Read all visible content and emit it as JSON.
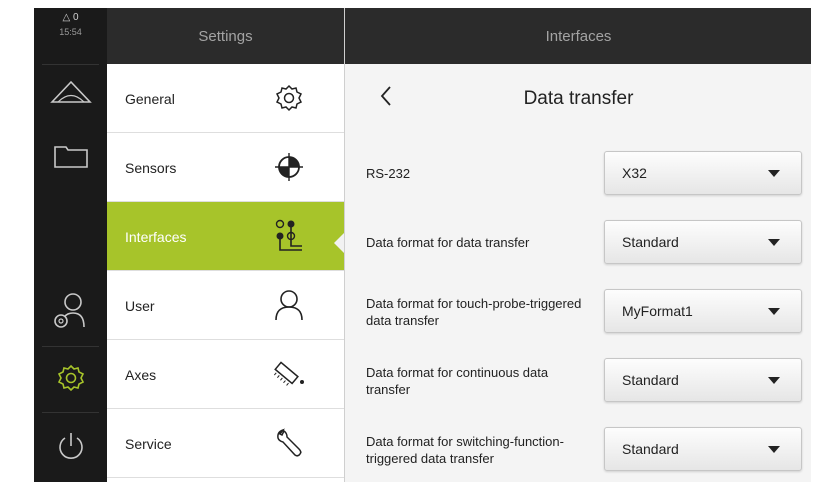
{
  "status": {
    "warning_count": "△ 0",
    "time": "15:54"
  },
  "strip": {
    "items": [
      {
        "icon": "measure-icon"
      },
      {
        "icon": "folder-icon"
      },
      {
        "icon": "user-settings-icon"
      },
      {
        "icon": "settings-gear-icon",
        "active": true
      },
      {
        "icon": "power-icon"
      }
    ],
    "active_color": "#a7c42a"
  },
  "settings": {
    "title": "Settings",
    "items": [
      {
        "label": "General",
        "icon": "gear-icon"
      },
      {
        "label": "Sensors",
        "icon": "sensor-icon"
      },
      {
        "label": "Interfaces",
        "icon": "interfaces-icon",
        "active": true
      },
      {
        "label": "User",
        "icon": "user-icon"
      },
      {
        "label": "Axes",
        "icon": "axes-icon"
      },
      {
        "label": "Service",
        "icon": "wrench-icon"
      }
    ]
  },
  "interfaces": {
    "title": "Interfaces",
    "page_title": "Data transfer",
    "rows": [
      {
        "label": "RS-232",
        "value": "X32"
      },
      {
        "label": "Data format for data transfer",
        "value": "Standard"
      },
      {
        "label": "Data format for touch-probe-triggered data transfer",
        "value": "MyFormat1"
      },
      {
        "label": "Data format for continuous data transfer",
        "value": "Standard"
      },
      {
        "label": "Data format for switching-function-triggered data transfer",
        "value": "Standard"
      }
    ]
  }
}
